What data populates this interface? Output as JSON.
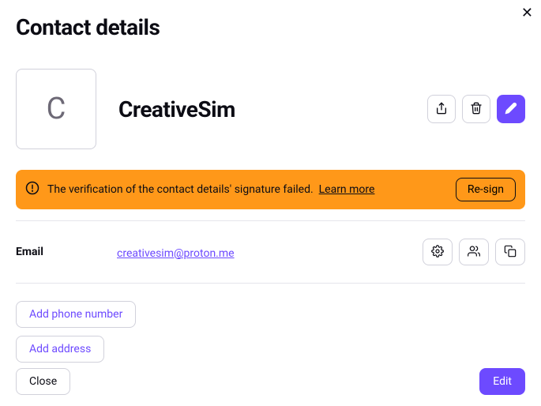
{
  "modal": {
    "title": "Contact details"
  },
  "contact": {
    "initial": "C",
    "name": "CreativeSim"
  },
  "alert": {
    "message": "The verification of the contact details' signature failed.",
    "learn_more": "Learn more",
    "resign": "Re-sign"
  },
  "fields": {
    "email_label": "Email",
    "email_value": "creativesim@proton.me"
  },
  "actions": {
    "add_phone": "Add phone number",
    "add_address": "Add address"
  },
  "footer": {
    "close": "Close",
    "edit": "Edit"
  }
}
